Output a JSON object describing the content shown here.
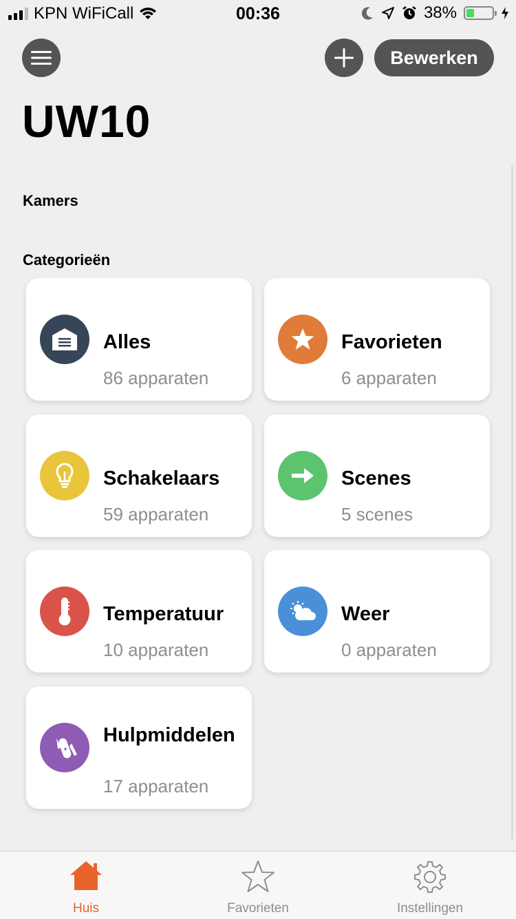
{
  "status_bar": {
    "carrier": "KPN WiFiCall",
    "time": "00:36",
    "battery_percent": "38%",
    "battery_level": 0.38
  },
  "header": {
    "edit_label": "Bewerken",
    "title": "UW10"
  },
  "sections": {
    "rooms": "Kamers",
    "categories": "Categorieën"
  },
  "categories": [
    {
      "name": "Alles",
      "sub": "86 apparaten",
      "icon": "house-icon",
      "color": "#364558"
    },
    {
      "name": "Favorieten",
      "sub": "6 apparaten",
      "icon": "star-icon",
      "color": "#e07b39"
    },
    {
      "name": "Schakelaars",
      "sub": "59 apparaten",
      "icon": "lightbulb-icon",
      "color": "#e9c53b"
    },
    {
      "name": "Scenes",
      "sub": "5 scenes",
      "icon": "arrow-right-icon",
      "color": "#5cc46f"
    },
    {
      "name": "Temperatuur",
      "sub": "10 apparaten",
      "icon": "thermometer-icon",
      "color": "#d9534a"
    },
    {
      "name": "Weer",
      "sub": "0 apparaten",
      "icon": "weather-icon",
      "color": "#4a90d9"
    },
    {
      "name": "Hulpmiddelen",
      "sub": "17 apparaten",
      "icon": "multitool-icon",
      "color": "#8e5bb5"
    }
  ],
  "tabs": [
    {
      "label": "Huis",
      "icon": "home-icon",
      "active": true
    },
    {
      "label": "Favorieten",
      "icon": "star-outline-icon",
      "active": false
    },
    {
      "label": "Instellingen",
      "icon": "gear-icon",
      "active": false
    }
  ],
  "colors": {
    "accent": "#e8632b",
    "button_bg": "#545454",
    "background": "#efefef"
  }
}
